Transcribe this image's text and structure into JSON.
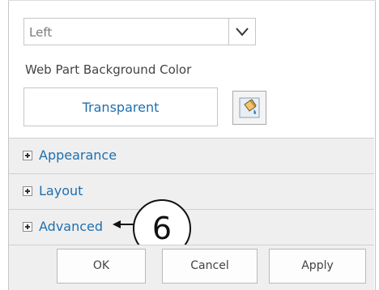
{
  "alignment": {
    "value": "Left"
  },
  "background": {
    "label": "Web Part Background Color",
    "value": "Transparent"
  },
  "sections": [
    {
      "label": "Appearance"
    },
    {
      "label": "Layout"
    },
    {
      "label": "Advanced"
    }
  ],
  "callout": {
    "number": "6"
  },
  "buttons": {
    "ok": "OK",
    "cancel": "Cancel",
    "apply": "Apply"
  },
  "colors": {
    "link": "#1f6fae",
    "section_bg": "#efefef",
    "border": "#c6c6c6"
  }
}
